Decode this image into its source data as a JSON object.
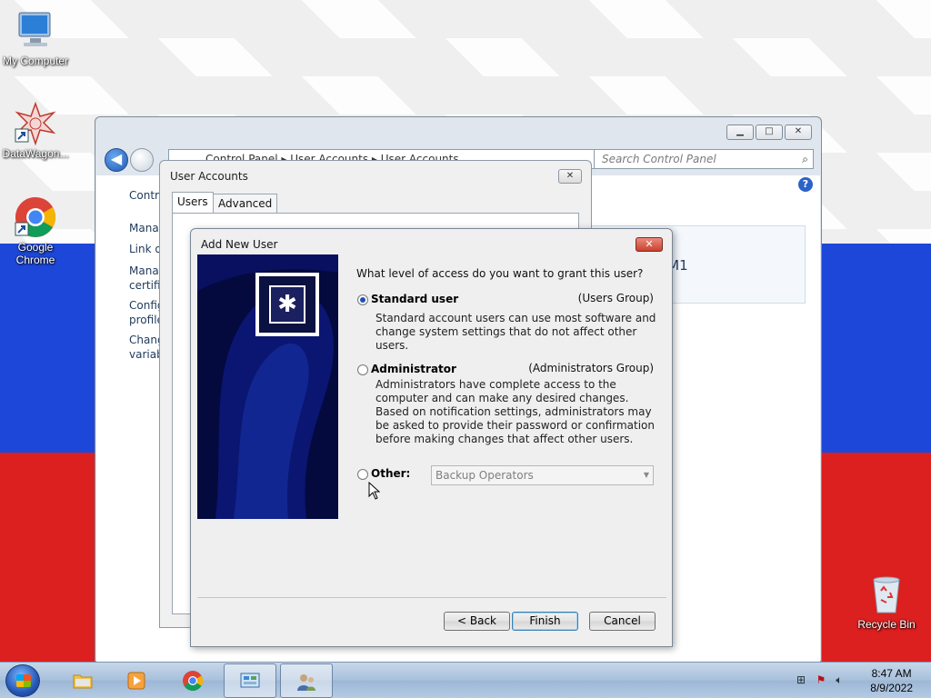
{
  "desktop": {
    "icons": [
      {
        "label": "My Computer"
      },
      {
        "label": "DataWagon..."
      },
      {
        "label": "Google Chrome"
      },
      {
        "label": "Recycle Bin"
      }
    ]
  },
  "control_panel": {
    "breadcrumb": "Control Panel  ▸  User Accounts  ▸  User Accounts",
    "search_placeholder": "Search Control Panel",
    "left_items": [
      "Contro",
      "Manag",
      "Link o",
      "Manag\ncertifi",
      "Config\nprofile",
      "Chang\nvariab"
    ],
    "info_text": "YM1"
  },
  "user_accounts": {
    "title": "User Accounts",
    "tabs": [
      "Users",
      "Advanced"
    ]
  },
  "add_new_user": {
    "title": "Add New User",
    "question": "What level of access do you want to grant this user?",
    "options": [
      {
        "label": "Standard user",
        "group": "(Users Group)",
        "checked": true,
        "description": "Standard account users can use most software and change system settings that do not affect other users."
      },
      {
        "label": "Administrator",
        "group": "(Administrators Group)",
        "checked": false,
        "description": "Administrators have complete access to the computer and can make any desired changes. Based on notification settings, administrators may be asked to provide their password or confirmation before making changes that affect other users."
      },
      {
        "label": "Other:",
        "checked": false,
        "select_value": "Backup Operators"
      }
    ],
    "buttons": {
      "back": "< Back",
      "finish": "Finish",
      "cancel": "Cancel"
    }
  },
  "taskbar": {
    "clock_time": "8:47 AM",
    "clock_date": "8/9/2022"
  },
  "colors": {
    "accent": "#1f4fb5",
    "wallpaper_blue": "#1d47d8",
    "wallpaper_red": "#dc1f1f",
    "banner": "#040a3e"
  }
}
